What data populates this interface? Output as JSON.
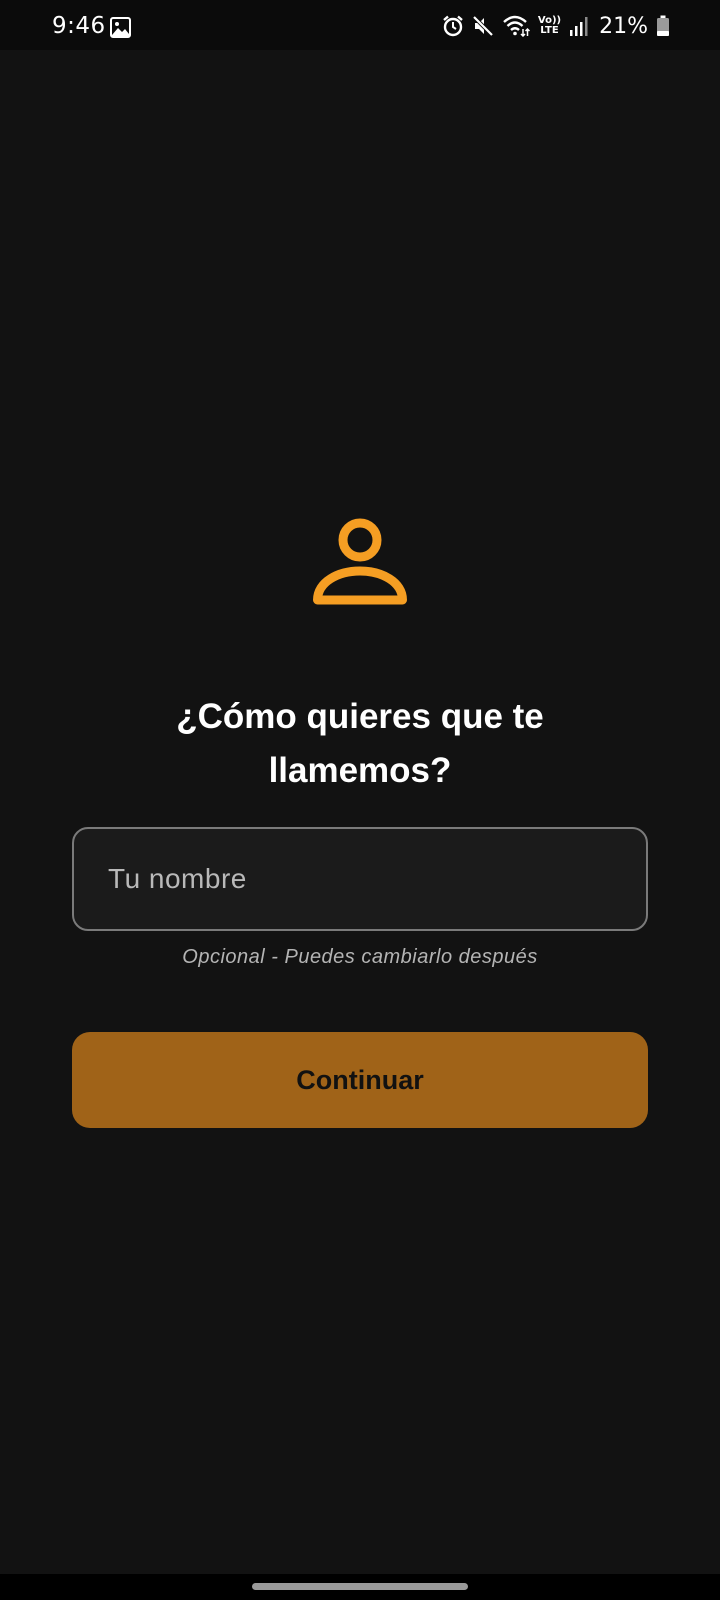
{
  "status_bar": {
    "time": "9:46",
    "volte_top": "Vo))",
    "volte_bottom": "LTE",
    "battery_percent": "21%",
    "icons": [
      "gallery-icon",
      "alarm-icon",
      "mute-icon",
      "wifi-icon",
      "signal-icon",
      "battery-icon"
    ]
  },
  "main": {
    "icon": "person-icon",
    "heading": "¿Cómo quieres que te llamemos?",
    "name_input": {
      "placeholder": "Tu nombre",
      "value": ""
    },
    "helper_text": "Opcional - Puedes cambiarlo después",
    "continue_label": "Continuar"
  },
  "colors": {
    "background": "#121212",
    "accent": "#F59E23",
    "button": "#A06318",
    "input_border": "#7A7A7A"
  }
}
